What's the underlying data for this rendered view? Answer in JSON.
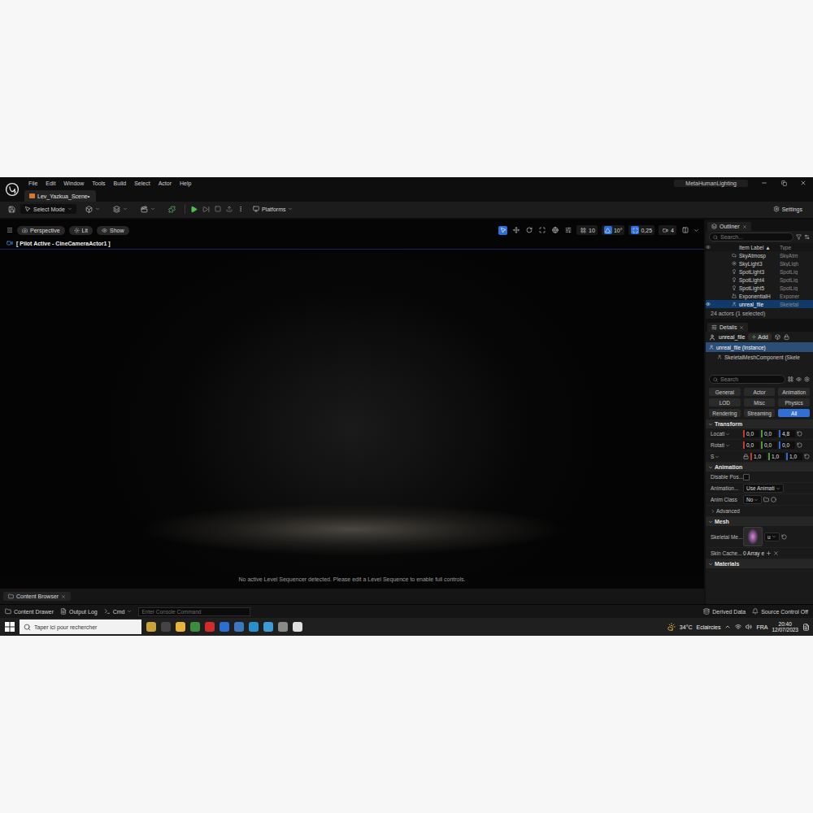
{
  "title_bar": {
    "menu": [
      "File",
      "Edit",
      "Window",
      "Tools",
      "Build",
      "Select",
      "Actor",
      "Help"
    ],
    "project": "MetaHumanLighting"
  },
  "level_tab": {
    "label": "Lev_Yazkua_Scene•",
    "selected": true
  },
  "toolbar": {
    "mode": "Select Mode",
    "platforms": "Platforms",
    "settings": "Settings"
  },
  "viewport": {
    "view_buttons": [
      "Perspective",
      "Lit",
      "Show"
    ],
    "snap": [
      {
        "value": "10",
        "active": false
      },
      {
        "value": "10°",
        "active": true
      },
      {
        "value": "0,25",
        "active": true
      },
      {
        "value": "4",
        "active": false
      }
    ],
    "pilot": "[ Pilot Active - CineCameraActor1 ]",
    "message": "No active Level Sequencer detected. Please edit a Level Sequence to enable full controls."
  },
  "content_browser": {
    "tab": "Content Browser"
  },
  "outliner": {
    "title": "Outliner",
    "search": "Search...",
    "columns": [
      "Item Label ▲",
      "Type"
    ],
    "rows": [
      {
        "label": "SkyAtmosp",
        "type": "SkyAtm",
        "selected": false
      },
      {
        "label": "SkyLight3",
        "type": "SkyLigh",
        "selected": false
      },
      {
        "label": "SpotLight3",
        "type": "SpotLig",
        "selected": false
      },
      {
        "label": "SpotLight4",
        "type": "SpotLig",
        "selected": false
      },
      {
        "label": "SpotLight5",
        "type": "SpotLig",
        "selected": false
      },
      {
        "label": "ExponentialH",
        "type": "Exponer",
        "selected": false
      },
      {
        "label": "unreal_file",
        "type": "Skeletal",
        "selected": true
      }
    ],
    "footer": "24 actors (1 selected)"
  },
  "details": {
    "title": "Details",
    "object": "unreal_file",
    "add": "Add",
    "components": [
      {
        "label": "unreal_file (Instance)",
        "selected": true
      },
      {
        "label": "SkeletalMeshComponent (Skele",
        "selected": false
      }
    ],
    "search": "Search",
    "filters": [
      {
        "label": "General",
        "selected": false
      },
      {
        "label": "Actor",
        "selected": false
      },
      {
        "label": "Animation",
        "selected": false
      },
      {
        "label": "LOD",
        "selected": false
      },
      {
        "label": "Misc",
        "selected": false
      },
      {
        "label": "Physics",
        "selected": false
      },
      {
        "label": "Rendering",
        "selected": false
      },
      {
        "label": "Streaming",
        "selected": false
      },
      {
        "label": "All",
        "selected": true
      }
    ],
    "sections": [
      {
        "title": "Transform",
        "expanded": true,
        "rows": [
          {
            "kind": "vector",
            "label": "Locati",
            "fields": [
              {
                "value": "0,0",
                "color": "#c8372d"
              },
              {
                "value": "0,0",
                "color": "#4e9a30"
              },
              {
                "value": "4,8",
                "color": "#3566cc"
              }
            ]
          },
          {
            "kind": "vector",
            "label": "Rotati",
            "fields": [
              {
                "value": "0,0",
                "color": "#c8372d"
              },
              {
                "value": "0,0",
                "color": "#4e9a30"
              },
              {
                "value": "0,0",
                "color": "#3566cc"
              }
            ]
          },
          {
            "kind": "scale",
            "label": "S",
            "fields": [
              {
                "value": "1,0",
                "color": "#c8372d"
              },
              {
                "value": "1,0",
                "color": "#4e9a30"
              },
              {
                "value": "1,0",
                "color": "#3566cc"
              }
            ]
          }
        ]
      },
      {
        "title": "Animation",
        "expanded": true,
        "rows": [
          {
            "kind": "checkbox",
            "label": "Disable Pos...",
            "checked": false
          },
          {
            "kind": "dropdown",
            "label": "Animation...",
            "value": "Use Animati"
          },
          {
            "kind": "dropdown",
            "label": "Anim Class",
            "value": "No"
          },
          {
            "kind": "group",
            "label": "Advanced",
            "expanded": false
          }
        ]
      },
      {
        "title": "Mesh",
        "expanded": true,
        "rows": [
          {
            "kind": "asset",
            "label": "Skeletal Me...",
            "value": "u"
          },
          {
            "kind": "array",
            "label": "Skin Cache...",
            "value": "0 Array e"
          }
        ]
      },
      {
        "title": "Materials",
        "expanded": true,
        "rows": []
      }
    ]
  },
  "status_bar": {
    "content_drawer": "Content Drawer",
    "output_log": "Output Log",
    "cmd": "Cmd",
    "console_placeholder": "Enter Console Command",
    "derived_data": "Derived Data",
    "source_control": "Source Control Off"
  },
  "taskbar": {
    "search": "Taper ici pour rechercher",
    "temperature": "34°C",
    "weather": "Eclaircies",
    "language": "FRA",
    "time": "20:40",
    "date": "12/07/2023"
  }
}
